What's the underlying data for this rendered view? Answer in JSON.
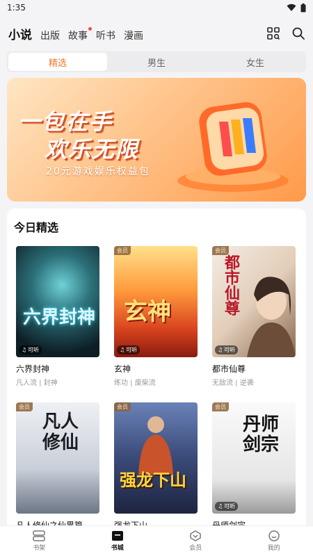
{
  "status": {
    "time": "1:35"
  },
  "nav": {
    "tabs": [
      {
        "label": "小说",
        "active": true,
        "dot": false
      },
      {
        "label": "出版",
        "active": false,
        "dot": false
      },
      {
        "label": "故事",
        "active": false,
        "dot": true
      },
      {
        "label": "听书",
        "active": false,
        "dot": false
      },
      {
        "label": "漫画",
        "active": false,
        "dot": false
      }
    ]
  },
  "segments": [
    {
      "label": "精选",
      "active": true
    },
    {
      "label": "男生",
      "active": false
    },
    {
      "label": "女生",
      "active": false
    }
  ],
  "banner": {
    "title_line1": "一包在手",
    "title_line2": "欢乐无限",
    "subtitle": "20元游戏娱乐权益包"
  },
  "section": {
    "title": "今日精选"
  },
  "books": [
    {
      "name": "六界封神",
      "tags": "凡人流 | 封神",
      "cover_title": "六界封神",
      "vip": false,
      "listen": true,
      "bg": "#1f3a3f"
    },
    {
      "name": "玄神",
      "tags": "练功 | 废柴流",
      "cover_title": "玄神",
      "vip": true,
      "listen": true,
      "bg": "#e8632a"
    },
    {
      "name": "都市仙尊",
      "tags": "无敌流 | 逆袭",
      "cover_title": "都市仙尊",
      "vip": true,
      "listen": true,
      "bg": "#e9dccf"
    },
    {
      "name": "凡人修仙之仙界篇",
      "tags": "",
      "cover_title": "凡人修仙",
      "vip": true,
      "listen": false,
      "bg": "#dfe3ea"
    },
    {
      "name": "强龙下山",
      "tags": "",
      "cover_title": "强龙下山",
      "vip": true,
      "listen": false,
      "bg": "#4a5b8a"
    },
    {
      "name": "丹师剑宗",
      "tags": "",
      "cover_title": "丹师剑宗",
      "vip": true,
      "listen": true,
      "bg": "#f2f2f2"
    }
  ],
  "labels": {
    "vip": "会员",
    "listen": "可听"
  },
  "bottom_nav": [
    {
      "label": "书架",
      "active": false
    },
    {
      "label": "书城",
      "active": true
    },
    {
      "label": "会员",
      "active": false
    },
    {
      "label": "我的",
      "active": false
    }
  ]
}
